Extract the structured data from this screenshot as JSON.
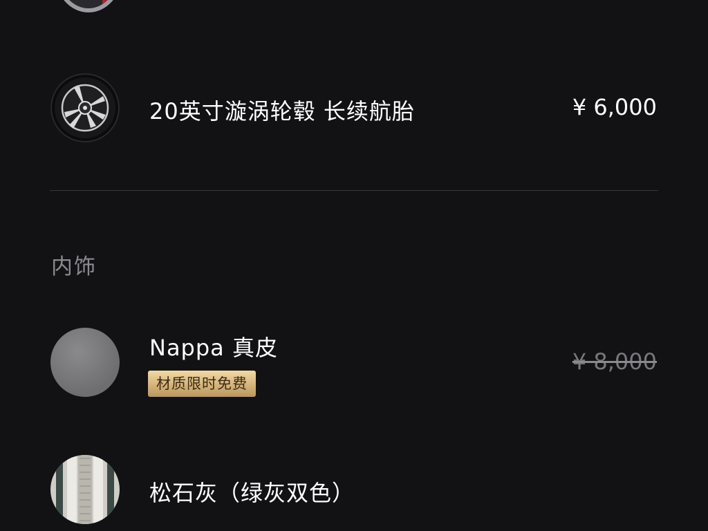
{
  "wheel_option": {
    "title": "20英寸漩涡轮毂 长续航胎",
    "price": "¥ 6,000",
    "icon": "wheel-icon"
  },
  "interior_section": {
    "title": "内饰"
  },
  "nappa_option": {
    "title": "Nappa 真皮",
    "badge": "材质限时免费",
    "original_price": "¥ 8,000",
    "icon": "leather-swatch"
  },
  "fabric_option": {
    "title": "松石灰（绿灰双色）",
    "icon": "fabric-swatch"
  },
  "colors": {
    "background": "#121215",
    "badge_gold": "#d5b47a",
    "muted_text": "#8a8a91",
    "strikethrough_price": "#77777c"
  }
}
